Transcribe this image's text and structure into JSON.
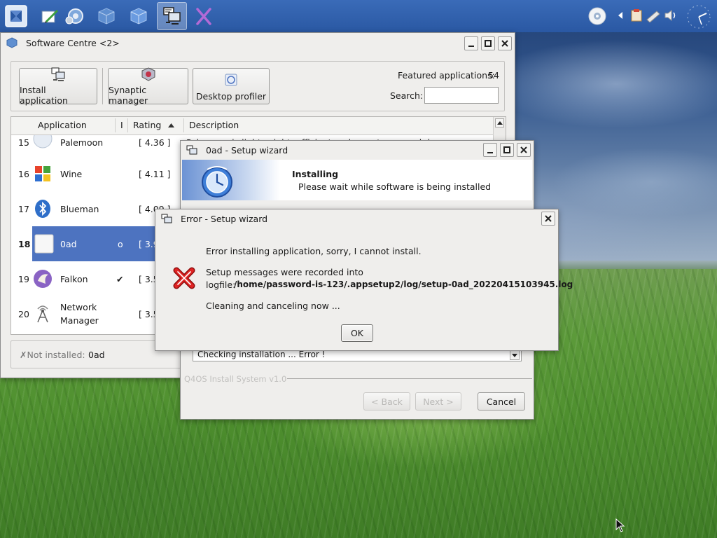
{
  "taskbar": {
    "apps": [
      {
        "name": "start-menu"
      },
      {
        "name": "text-editor"
      },
      {
        "name": "system-settings"
      },
      {
        "name": "software-centre-1"
      },
      {
        "name": "software-centre-2"
      },
      {
        "name": "setup-wizard"
      },
      {
        "name": "x-app"
      }
    ]
  },
  "software_centre": {
    "title": "Software Centre <2>",
    "toolbar": {
      "install_label": "Install application",
      "synaptic_label": "Synaptic manager",
      "profiler_label": "Desktop profiler"
    },
    "featured_label": "Featured applications:",
    "featured_count": "54",
    "search_label": "Search:",
    "search_value": "",
    "columns": {
      "application": "Application",
      "installed": "I",
      "rating": "Rating",
      "description": "Description"
    },
    "rows": [
      {
        "num": "15",
        "name": "Palemoon",
        "installed": "",
        "rating": "[ 4.36 ]",
        "description": "Palemoon is lightweight, efficient and easy to use web browser."
      },
      {
        "num": "16",
        "name": "Wine",
        "installed": "",
        "rating": "[ 4.11 ]",
        "description": ""
      },
      {
        "num": "17",
        "name": "Blueman",
        "installed": "",
        "rating": "[ 4.09 ]",
        "description": ""
      },
      {
        "num": "18",
        "name": "0ad",
        "installed": "o",
        "rating": "[ 3.9",
        "description": ""
      },
      {
        "num": "19",
        "name": "Falkon",
        "installed": "✔",
        "rating": "[ 3.5",
        "description": ""
      },
      {
        "num": "20",
        "name": "Network",
        "name2": "Manager",
        "installed": "",
        "rating": "[ 3.5",
        "description": ""
      }
    ],
    "status_prefix": "✗Not installed:",
    "status_value": "0ad"
  },
  "setup_wizard": {
    "title": "0ad - Setup wizard",
    "heading": "Installing",
    "subheading": "Please wait while software is being installed",
    "progress_text": "Checking installation ... Error !",
    "footer": "Q4OS Install System v1.0",
    "back_label": "< Back",
    "next_label": "Next >",
    "cancel_label": "Cancel"
  },
  "error_dialog": {
    "title": "Error - Setup wizard",
    "line1": "Error installing application, sorry, I cannot install.",
    "line2": "Setup messages were recorded into",
    "logfile_prefix": "logfile:",
    "logfile_path": "/home/password-is-123/.appsetup2/log/setup-0ad_20220415103945.log",
    "line4": "Cleaning and canceling now ...",
    "ok_label": "OK"
  },
  "colors": {
    "taskbar": "#2a58a3",
    "selection": "#4d73c0",
    "error_red": "#d41c1c"
  }
}
